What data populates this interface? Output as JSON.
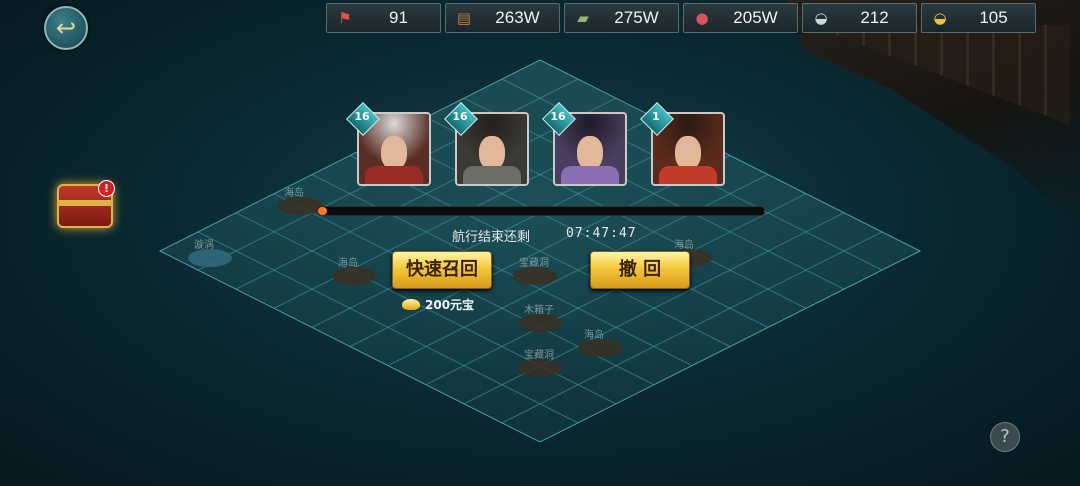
{
  "resources": [
    {
      "icon": "red-token-icon",
      "glyph": "⚑",
      "color": "#e5533a",
      "value": "91"
    },
    {
      "icon": "wood-logs-icon",
      "glyph": "▤",
      "color": "#b77a3c",
      "value": "263W"
    },
    {
      "icon": "stone-slab-icon",
      "glyph": "▰",
      "color": "#9db07a",
      "value": "275W"
    },
    {
      "icon": "meat-icon",
      "glyph": "●",
      "color": "#d9535b",
      "value": "205W"
    },
    {
      "icon": "silver-ingot-icon",
      "glyph": "◒",
      "color": "#cfd7da",
      "value": "212"
    },
    {
      "icon": "gold-ingot-icon",
      "glyph": "◒",
      "color": "#f2c230",
      "value": "105"
    }
  ],
  "heroes": [
    {
      "name": "white-haired-general-portrait",
      "level": "16",
      "hair": "#d9d9d9",
      "robe": "#9a2b25",
      "bg": "#5a2e25"
    },
    {
      "name": "young-swordsman-portrait",
      "level": "16",
      "hair": "#24201c",
      "robe": "#6e6c66",
      "bg": "#3b3a35"
    },
    {
      "name": "lady-with-hairpin-portrait",
      "level": "16",
      "hair": "#1d1a26",
      "robe": "#8a6fb4",
      "bg": "#4a3e5e"
    },
    {
      "name": "heroine-with-crown-portrait",
      "level": "1",
      "hair": "#2a1a14",
      "robe": "#c23a2a",
      "bg": "#5c2a1c"
    }
  ],
  "voyage": {
    "remaining_label": "航行结束还剩",
    "remaining_time": "07:47:47",
    "progress_fraction": 0.02
  },
  "buttons": {
    "quick_recall": "快速召回",
    "withdraw": "撤 回"
  },
  "cost": {
    "amount_label": "200元宝"
  },
  "chest_alert": "!",
  "help": "?",
  "back_glyph": "↩",
  "islands": [
    {
      "label": "海岛"
    },
    {
      "label": "海岛"
    },
    {
      "label": "宝藏洞"
    },
    {
      "label": "海岛"
    },
    {
      "label": "木箱子"
    },
    {
      "label": "海岛"
    },
    {
      "label": "宝藏洞"
    },
    {
      "label": "漩涡"
    }
  ],
  "colors": {
    "accent_gold": "#f3c83a",
    "progress": "#ff7a1a",
    "grid_line": "#3f8f97"
  }
}
